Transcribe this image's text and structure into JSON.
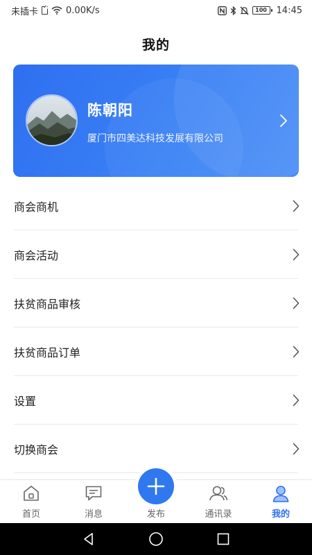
{
  "status_bar": {
    "carrier": "未插卡",
    "speed": "0.00K/s",
    "battery": "100",
    "time": "14:45"
  },
  "header": {
    "title": "我的"
  },
  "profile": {
    "name": "陈朝阳",
    "company": "厦门市四美达科技发展有限公司"
  },
  "menu": {
    "items": [
      {
        "label": "商会商机"
      },
      {
        "label": "商会活动"
      },
      {
        "label": "扶贫商品审核"
      },
      {
        "label": "扶贫商品订单"
      },
      {
        "label": "设置"
      },
      {
        "label": "切换商会"
      }
    ]
  },
  "tabbar": {
    "items": [
      {
        "label": "首页",
        "icon": "home-icon"
      },
      {
        "label": "消息",
        "icon": "message-icon"
      },
      {
        "label": "发布",
        "icon": "plus-icon"
      },
      {
        "label": "通讯录",
        "icon": "contacts-icon"
      },
      {
        "label": "我的",
        "icon": "user-icon",
        "active": true
      }
    ]
  },
  "colors": {
    "accent": "#2f6ff0",
    "card_gradient_start": "#2f6ff0",
    "card_gradient_end": "#4a8ef7",
    "inactive_tab": "#666666"
  }
}
